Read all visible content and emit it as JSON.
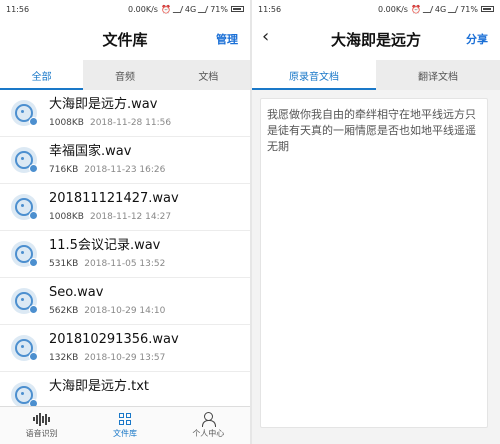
{
  "left": {
    "status": {
      "time": "11:56",
      "network": "0.00K/s",
      "carrier": "4G",
      "battery": "71%"
    },
    "title": "文件库",
    "action": "管理",
    "tabs": [
      {
        "label": "全部",
        "active": true
      },
      {
        "label": "音频",
        "active": false
      },
      {
        "label": "文档",
        "active": false
      }
    ],
    "files": [
      {
        "name": "大海即是远方.wav",
        "size": "1008KB",
        "date": "2018-11-28 11:56"
      },
      {
        "name": "幸福国家.wav",
        "size": "716KB",
        "date": "2018-11-23 16:26"
      },
      {
        "name": "201811121427.wav",
        "size": "1008KB",
        "date": "2018-11-12 14:27"
      },
      {
        "name": "11.5会议记录.wav",
        "size": "531KB",
        "date": "2018-11-05 13:52"
      },
      {
        "name": "Seo.wav",
        "size": "562KB",
        "date": "2018-10-29 14:10"
      },
      {
        "name": "201810291356.wav",
        "size": "132KB",
        "date": "2018-10-29 13:57"
      },
      {
        "name": "大海即是远方.txt",
        "size": "",
        "date": ""
      }
    ],
    "bottom_nav": [
      {
        "label": "语音识别",
        "icon": "waveform-icon"
      },
      {
        "label": "文件库",
        "icon": "grid-icon",
        "active": true
      },
      {
        "label": "个人中心",
        "icon": "person-icon"
      }
    ]
  },
  "right": {
    "status": {
      "time": "11:56",
      "network": "0.00K/s",
      "carrier": "4G",
      "battery": "71%"
    },
    "back_icon": "‹",
    "title": "大海即是远方",
    "action": "分享",
    "tabs": [
      {
        "label": "原录音文档",
        "active": true
      },
      {
        "label": "翻译文档",
        "active": false
      }
    ],
    "document_text": "我愿做你我自由的牵绊相守在地平线远方只是徒有天真的一厢情愿是否也如地平线遥遥无期"
  },
  "colors": {
    "accent": "#1a78c8",
    "tab_inactive_bg": "#ececec"
  }
}
